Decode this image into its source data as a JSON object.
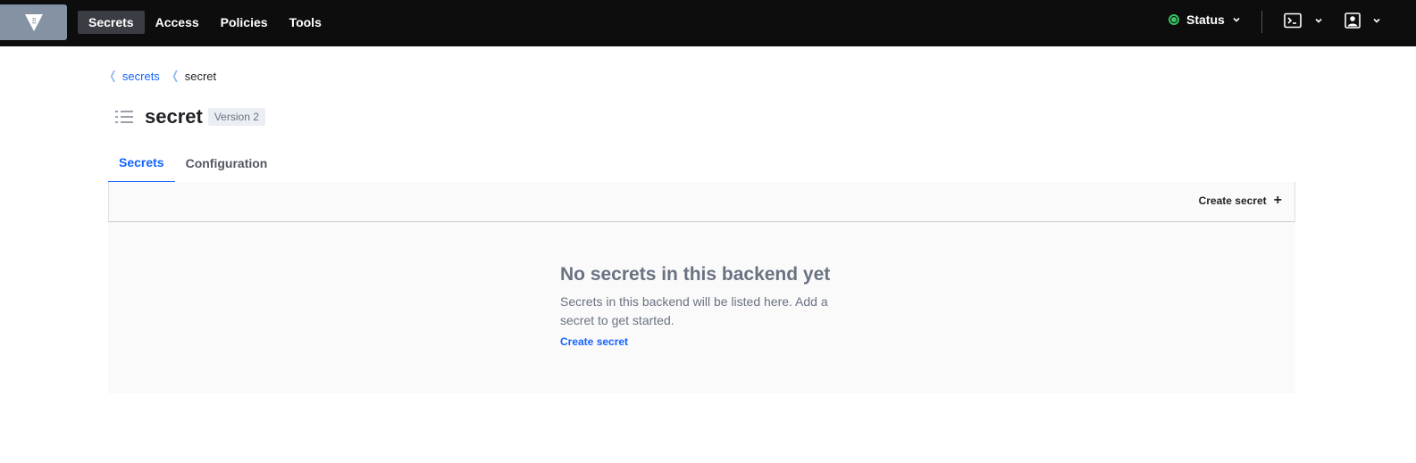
{
  "nav": {
    "logo_icon": "vault-logo-icon",
    "items": [
      {
        "label": "Secrets",
        "active": true
      },
      {
        "label": "Access",
        "active": false
      },
      {
        "label": "Policies",
        "active": false
      },
      {
        "label": "Tools",
        "active": false
      }
    ],
    "status_label": "Status",
    "status_color": "#3ac162",
    "console_icon": "terminal-icon",
    "user_icon": "user-square-icon"
  },
  "breadcrumb": {
    "items": [
      {
        "label": "secrets",
        "link": true
      },
      {
        "label": "secret",
        "link": false
      }
    ]
  },
  "header": {
    "icon": "list-icon",
    "title": "secret",
    "version": "Version 2"
  },
  "tabs": [
    {
      "label": "Secrets",
      "active": true
    },
    {
      "label": "Configuration",
      "active": false
    }
  ],
  "toolbar": {
    "create_label": "Create secret",
    "create_icon": "plus-icon"
  },
  "empty_state": {
    "title": "No secrets in this backend yet",
    "message": "Secrets in this backend will be listed here. Add a secret to get started.",
    "link": "Create secret"
  },
  "colors": {
    "accent": "#1563ff",
    "topbar": "#0d0d0d"
  }
}
